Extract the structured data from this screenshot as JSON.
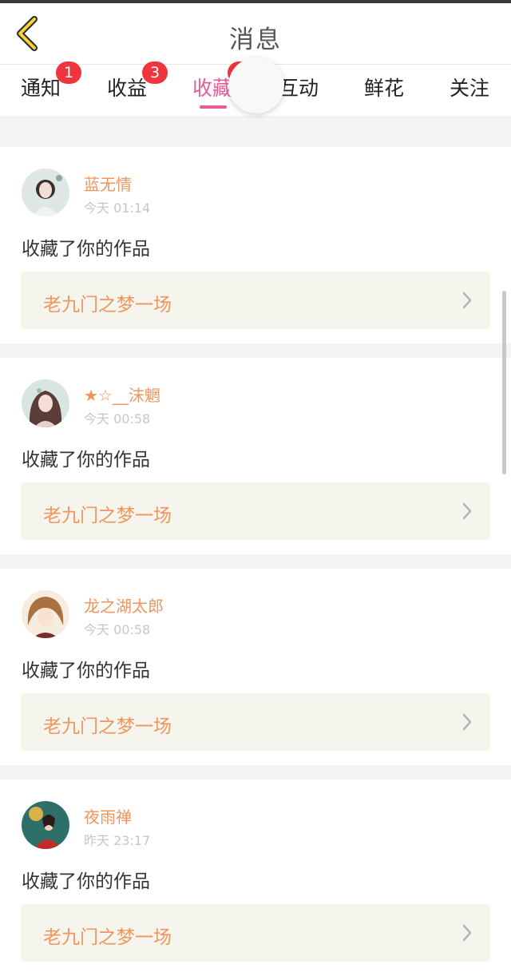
{
  "header": {
    "title": "消息",
    "back_icon": "chevron-left-icon"
  },
  "tabs": [
    {
      "label": "通知",
      "badge": "1"
    },
    {
      "label": "收益",
      "badge": "3"
    },
    {
      "label": "收藏",
      "badge": "",
      "active": true
    },
    {
      "label": "互动"
    },
    {
      "label": "鲜花"
    },
    {
      "label": "关注"
    }
  ],
  "colors": {
    "accent": "#ea5b9a",
    "username": "#ee9560",
    "badge": "#f0353f",
    "link_bg": "#f5f5ee"
  },
  "messages": [
    {
      "username": "蓝无情",
      "time": "今天 01:14",
      "action": "收藏了你的作品",
      "work_title": "老九门之梦一场"
    },
    {
      "username": "★☆__沫魍",
      "time": "今天 00:58",
      "action": "收藏了你的作品",
      "work_title": "老九门之梦一场"
    },
    {
      "username": "龙之湖太郎",
      "time": "今天 00:58",
      "action": "收藏了你的作品",
      "work_title": "老九门之梦一场"
    },
    {
      "username": "夜雨禅",
      "time": "昨天 23:17",
      "action": "收藏了你的作品",
      "work_title": "老九门之梦一场"
    }
  ]
}
